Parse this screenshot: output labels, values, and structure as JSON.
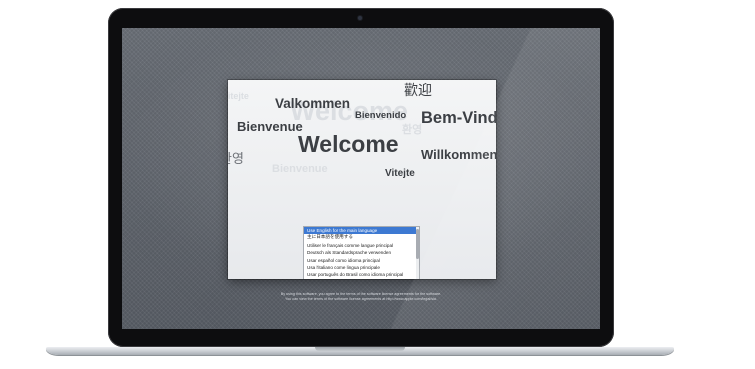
{
  "welcome": {
    "words": [
      {
        "text": "Welcome",
        "style": "ghost"
      },
      {
        "text": "Bienvenue",
        "style": "ghost"
      },
      {
        "text": "Vitejte",
        "style": "ghost"
      },
      {
        "text": "환영",
        "style": "ghost"
      },
      {
        "text": "Valkommen",
        "style": "dark"
      },
      {
        "text": "歡迎",
        "style": "dark"
      },
      {
        "text": "Bienvenido",
        "style": "dark"
      },
      {
        "text": "Bienvenue",
        "style": "dark"
      },
      {
        "text": "Bem-Vind",
        "style": "dark"
      },
      {
        "text": "Welcome",
        "style": "dark"
      },
      {
        "text": "Willkommen",
        "style": "dark"
      },
      {
        "text": "환영",
        "style": "mid"
      },
      {
        "text": "Vitejte",
        "style": "dark"
      }
    ]
  },
  "language_list": {
    "items": [
      "Use English for the main language",
      "主に日本語を使用する",
      "Utiliser le français comme langue principal",
      "Deutsch als Standardsprache verwenden",
      "Usar español como idioma principal",
      "Usa l'italiano come lingua principale",
      "Usar português do Brasil como idioma principal"
    ],
    "selected_index": 0
  },
  "legal": {
    "line1": "By using this software, you agree to the terms of the software license agreements for the software.",
    "line2": "You can view the terms of the software license agreements at http://www.apple.com/legal/sla."
  },
  "icons": {
    "continue": "continue-arrow-icon",
    "camera": "camera-icon"
  },
  "colors": {
    "selection": "#3d79d2",
    "desktop": "#62676f",
    "bezel": "#0d0d0f"
  }
}
